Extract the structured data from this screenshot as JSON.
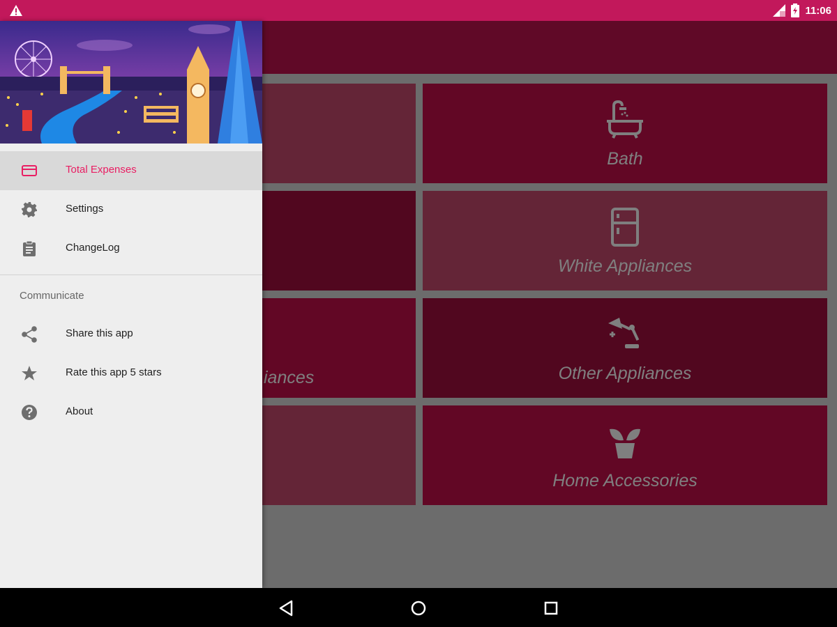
{
  "status_bar": {
    "time": "11:06",
    "icons": [
      "warning-icon",
      "signal-icon",
      "battery-icon"
    ]
  },
  "tiles": [
    {
      "label": "",
      "icon": "none",
      "color": "#c94b6e"
    },
    {
      "label": "Bath",
      "icon": "bathtub-icon",
      "color": "#c40f4a"
    },
    {
      "label": "",
      "icon": "none",
      "color": "#a30f3f"
    },
    {
      "label": "White Appliances",
      "icon": "fridge-icon",
      "color": "#c94b6e"
    },
    {
      "label": "iances",
      "icon": "none",
      "color": "#c40f4a"
    },
    {
      "label": "Other Appliances",
      "icon": "desk-lamp-icon",
      "color": "#a30f3f"
    },
    {
      "label": "",
      "icon": "none",
      "color": "#c94b6e"
    },
    {
      "label": "Home Accessories",
      "icon": "plant-icon",
      "color": "#c40f4a"
    }
  ],
  "drawer": {
    "items": [
      {
        "label": "Total Expenses",
        "icon": "credit-card-icon",
        "active": true
      },
      {
        "label": "Settings",
        "icon": "gear-icon",
        "active": false
      },
      {
        "label": "ChangeLog",
        "icon": "clipboard-icon",
        "active": false
      }
    ],
    "section_title": "Communicate",
    "communicate_items": [
      {
        "label": "Share this app",
        "icon": "share-icon"
      },
      {
        "label": "Rate this app 5 stars",
        "icon": "star-icon"
      },
      {
        "label": "About",
        "icon": "help-icon"
      }
    ]
  },
  "colors": {
    "accent": "#e91e63",
    "status_bar": "#c2185b",
    "primary": "#c0134e"
  },
  "nav_bar": {
    "buttons": [
      "back-icon",
      "home-icon",
      "recents-icon"
    ]
  }
}
